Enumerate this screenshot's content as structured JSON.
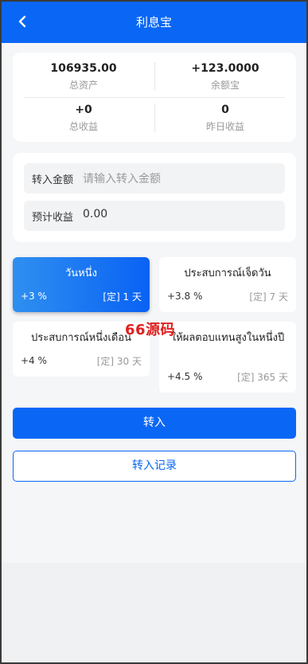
{
  "header": {
    "title": "利息宝",
    "back_icon": "chevron-left-icon"
  },
  "stats": [
    {
      "value": "106935.00",
      "label": "总资产"
    },
    {
      "value": "+123.0000",
      "label": "余额宝"
    },
    {
      "value": "+0",
      "label": "总收益"
    },
    {
      "value": "0",
      "label": "昨日收益"
    }
  ],
  "form": {
    "amount_label": "转入金额",
    "amount_placeholder": "请输入转入金额",
    "expected_label": "预计收益",
    "expected_value": "0.00"
  },
  "plans": [
    {
      "name": "วันหนึ่ง",
      "rate": "+3 %",
      "duration": "[定] 1 天",
      "selected": true
    },
    {
      "name": "ประสบการณ์เจ็ดวัน",
      "rate": "+3.8 %",
      "duration": "[定] 7 天",
      "selected": false
    },
    {
      "name": "ประสบการณ์หนึ่งเดือน",
      "rate": "+4 %",
      "duration": "[定] 30 天",
      "selected": false
    },
    {
      "name": "ให้ผลตอบแทนสูงในหนึ่งปี",
      "rate": "+4.5 %",
      "duration": "[定] 365 天",
      "selected": false
    }
  ],
  "watermark": "66源码",
  "buttons": {
    "transfer_in": "转入",
    "transfer_record": "转入记录"
  },
  "colors": {
    "primary": "#0a67f5",
    "background": "#f5f6f8",
    "watermark": "#e02020"
  }
}
